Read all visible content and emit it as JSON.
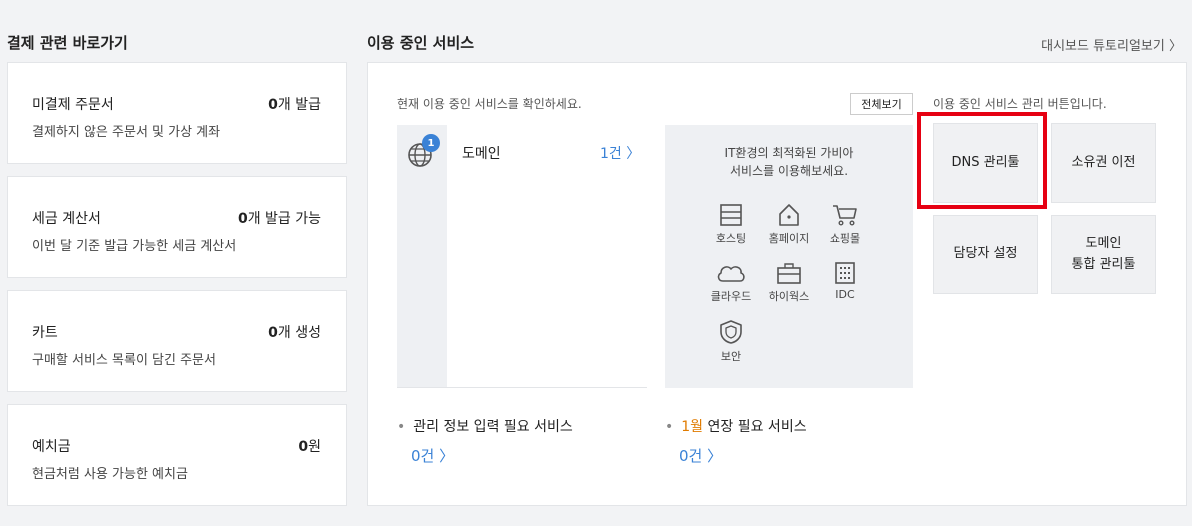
{
  "left": {
    "title": "결제 관련 바로가기",
    "cards": [
      {
        "title": "미결제 주문서",
        "count": "0",
        "count_suffix": "개 발급",
        "desc": "결제하지 않은 주문서 및 가상 계좌"
      },
      {
        "title": "세금 계산서",
        "count": "0",
        "count_suffix": "개 발급 가능",
        "desc": "이번 달 기준 발급 가능한 세금 계산서"
      },
      {
        "title": "카트",
        "count": "0",
        "count_suffix": "개 생성",
        "desc": "구매할 서비스 목록이 담긴 주문서"
      },
      {
        "title": "예치금",
        "count": "0",
        "count_suffix": "원",
        "desc": "현금처럼 사용 가능한 예치금"
      }
    ]
  },
  "right": {
    "title": "이용 중인 서비스",
    "tutorial_link": "대시보드 튜토리얼보기 〉",
    "desc": "현재 이용 중인 서비스를 확인하세요.",
    "view_all": "전체보기",
    "domain": {
      "badge": "1",
      "label": "도메인",
      "count": "1건 〉"
    },
    "promo": {
      "line1": "IT환경의 최적화된 가비아",
      "line2": "서비스를 이용해보세요.",
      "services": [
        "호스팅",
        "홈페이지",
        "쇼핑몰",
        "클라우드",
        "하이웍스",
        "IDC",
        "보안"
      ]
    },
    "tools_desc": "이용 중인 서비스 관리 버튼입니다.",
    "tools": {
      "dns": "DNS 관리툴",
      "transfer": "소유권 이전",
      "contact": "담당자 설정",
      "domain_l1": "도메인",
      "domain_l2": "통합 관리툴"
    },
    "bottom": {
      "info_label": "관리 정보 입력 필요 서비스",
      "info_count": "0건 〉",
      "renew_month": "1월",
      "renew_label": " 연장 필요 서비스",
      "renew_count": "0건 〉"
    }
  },
  "colors": {
    "accent": "#3a82d6",
    "highlight": "#e60012",
    "month": "#e07b00"
  }
}
